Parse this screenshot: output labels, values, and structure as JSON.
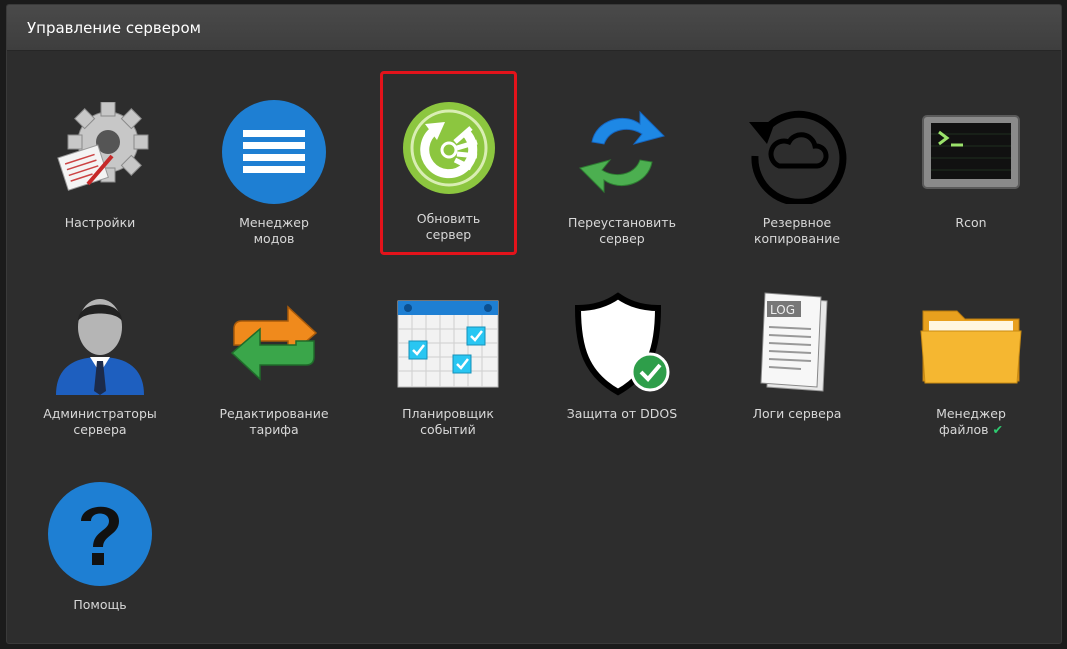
{
  "header": {
    "title": "Управление сервером"
  },
  "tiles": [
    {
      "label1": "Настройки",
      "label2": "",
      "icon": "settings-gear-icon"
    },
    {
      "label1": "Менеджер",
      "label2": "модов",
      "icon": "mod-manager-icon"
    },
    {
      "label1": "Обновить",
      "label2": "сервер",
      "icon": "update-server-icon",
      "selected": true
    },
    {
      "label1": "Переустановить",
      "label2": "сервер",
      "icon": "reinstall-arrows-icon"
    },
    {
      "label1": "Резервное",
      "label2": "копирование",
      "icon": "cloud-backup-icon"
    },
    {
      "label1": "Rcon",
      "label2": "",
      "icon": "terminal-icon"
    },
    {
      "label1": "Администраторы",
      "label2": "сервера",
      "icon": "admin-user-icon"
    },
    {
      "label1": "Редактирование",
      "label2": "тарифа",
      "icon": "tariff-arrows-icon"
    },
    {
      "label1": "Планировщик",
      "label2": "событий",
      "icon": "calendar-icon"
    },
    {
      "label1": "Защита от DDOS",
      "label2": "",
      "icon": "shield-check-icon"
    },
    {
      "label1": "Логи сервера",
      "label2": "",
      "icon": "log-document-icon"
    },
    {
      "label1": "Менеджер",
      "label2": "файлов",
      "icon": "folder-icon",
      "check": "✔"
    },
    {
      "label1": "Помощь",
      "label2": "",
      "icon": "help-question-icon"
    }
  ],
  "colors": {
    "selection": "#e3131b",
    "blue": "#1e7fd3",
    "green": "#8cc63f",
    "check": "#2ecc71"
  }
}
